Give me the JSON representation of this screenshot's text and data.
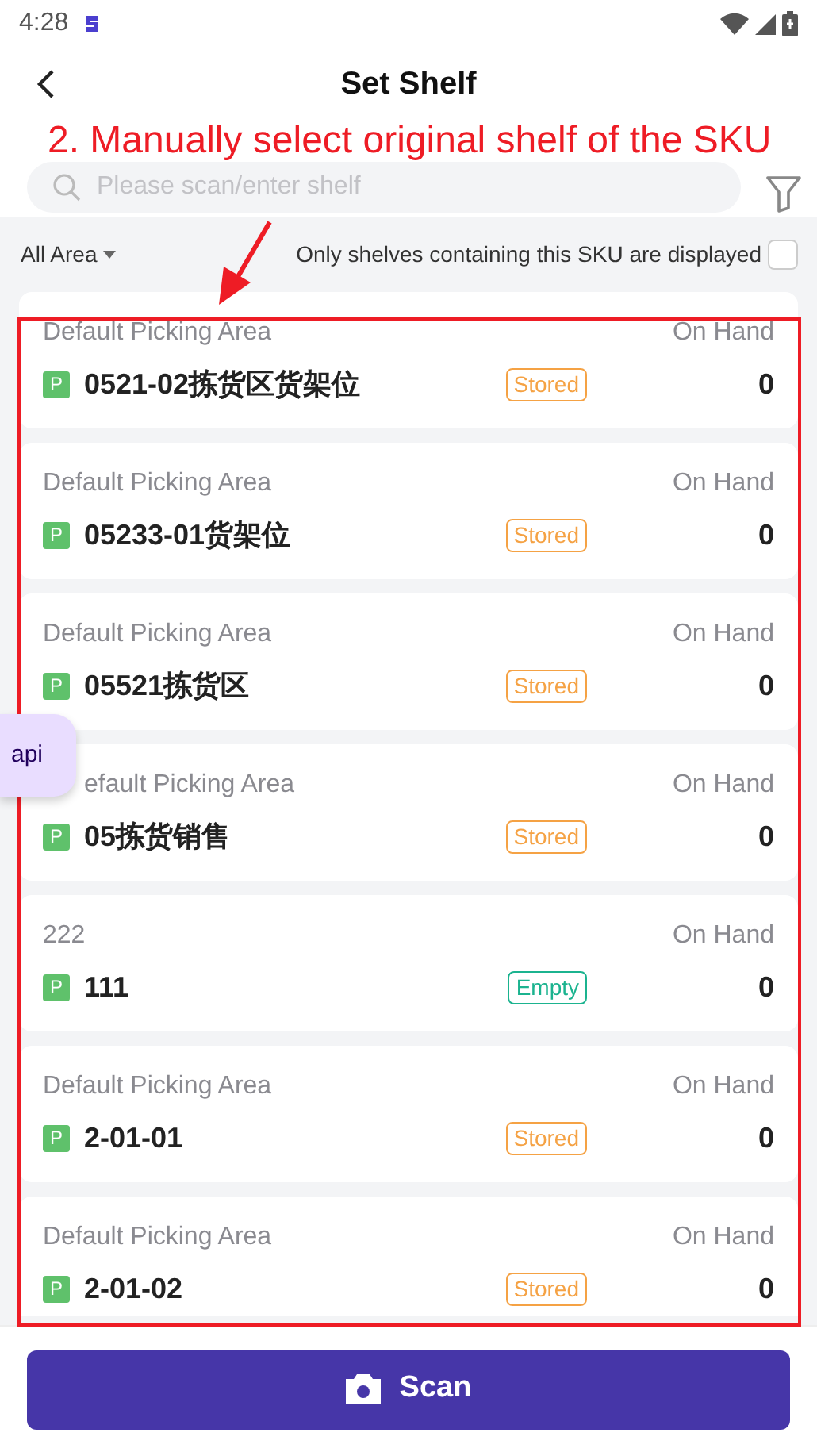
{
  "status_bar": {
    "time": "4:28"
  },
  "header": {
    "title": "Set Shelf"
  },
  "annotation": {
    "text": "2. Manually select original shelf of the SKU"
  },
  "search": {
    "placeholder": "Please scan/enter shelf"
  },
  "filter": {
    "area": "All Area",
    "only_sku_label": "Only shelves containing this SKU are displayed",
    "checked": false
  },
  "floating_button": {
    "label": "api"
  },
  "shelves": [
    {
      "area": "Default Picking Area",
      "qty_label": "On Hand",
      "type": "P",
      "name": "0521-02拣货区货架位",
      "tag": {
        "label": "Stored",
        "color": "#f5a244"
      },
      "qty": "0"
    },
    {
      "area": "Default Picking Area",
      "qty_label": "On Hand",
      "type": "P",
      "name": "05233-01货架位",
      "tag": {
        "label": "Stored",
        "color": "#f5a244"
      },
      "qty": "0"
    },
    {
      "area": "Default Picking Area",
      "qty_label": "On Hand",
      "type": "P",
      "name": "05521拣货区",
      "tag": {
        "label": "Stored",
        "color": "#f5a244"
      },
      "qty": "0"
    },
    {
      "area": "efault Picking Area",
      "qty_label": "On Hand",
      "type": "P",
      "name": "05拣货销售",
      "tag": {
        "label": "Stored",
        "color": "#f5a244"
      },
      "qty": "0"
    },
    {
      "area": "222",
      "qty_label": "On Hand",
      "type": "P",
      "name": "111",
      "tag": {
        "label": "Empty",
        "color": "#1bb38f"
      },
      "qty": "0"
    },
    {
      "area": "Default Picking Area",
      "qty_label": "On Hand",
      "type": "P",
      "name": "2-01-01",
      "tag": {
        "label": "Stored",
        "color": "#f5a244"
      },
      "qty": "0"
    },
    {
      "area": "Default Picking Area",
      "qty_label": "On Hand",
      "type": "P",
      "name": "2-01-02",
      "tag": {
        "label": "Stored",
        "color": "#f5a244"
      },
      "qty": "0"
    }
  ],
  "scan_button": {
    "label": "Scan"
  }
}
